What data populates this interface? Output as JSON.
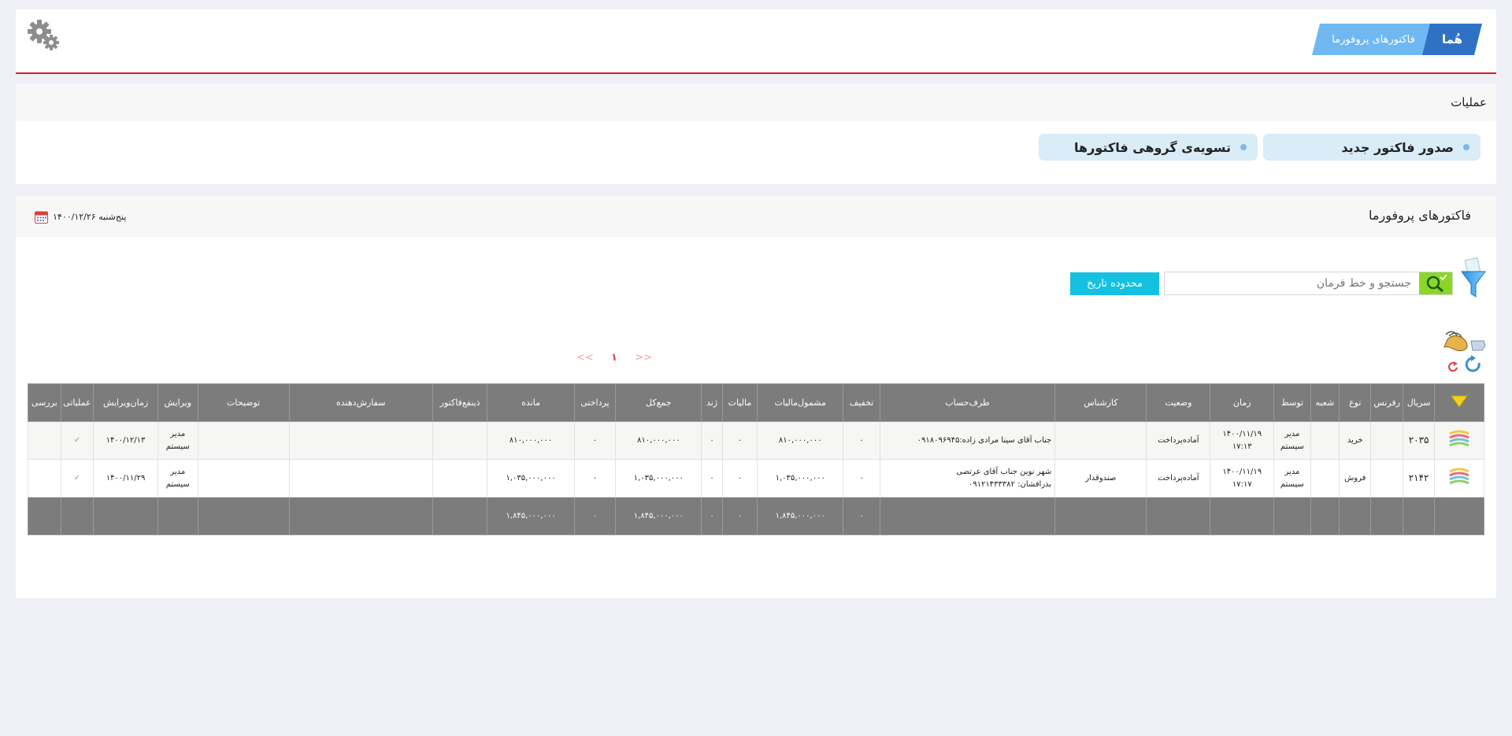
{
  "header": {
    "breadcrumb_home": "هُما",
    "breadcrumb_page": "فاکتورهای پروفورما"
  },
  "operations": {
    "title": "عملیات",
    "new_invoice": "صدور فاکتور جدید",
    "group_settle": "تسویه‌ی گروهی فاکتورها"
  },
  "invoices": {
    "title": "فاکتورهای پروفورما",
    "date": "پنج‌شنبه ۱۴۰۰/۱۲/۲۶",
    "search_placeholder": "جستجو و خط فرمان",
    "date_range_label": "محدوده تاریخ",
    "pager": {
      "prev": "<<",
      "page": "۱",
      "next": ">>"
    },
    "columns": [
      "سریال",
      "رفرنس",
      "نوع",
      "شعبه",
      "توسط",
      "زمان",
      "وضعیت",
      "کارشناس",
      "طرف‌حساب",
      "تخفیف",
      "مشمول‌مالیات",
      "مالیات",
      "ژند",
      "جمع‌کل",
      "پرداختی",
      "مانده",
      "ذینفع‌فاکتور",
      "سفارش‌دهنده",
      "توضیحات",
      "ویرایش",
      "زمان‌ویرایش",
      "عملیاتی",
      "بررسی"
    ],
    "rows": [
      {
        "serial": "۲۰۳۵",
        "type": "خرید",
        "by_1": "مدیر",
        "by_2": "سیستم",
        "date": "۱۴۰۰/۱۱/۱۹",
        "time": "۱۷:۱۳",
        "status": "آماده‌پرداخت",
        "expert": "",
        "party_1": "جناب آقای سینا مرادی زاده:۰۹۱۸۰۹۶۹۴۵",
        "party_2": "",
        "discount": "۰",
        "taxable": "۸۱۰,۰۰۰,۰۰۰",
        "tax": "۰",
        "zhand": "۰",
        "total": "۸۱۰,۰۰۰,۰۰۰",
        "paid": "۰",
        "remaining": "۸۱۰,۰۰۰,۰۰۰",
        "editor_1": "مدیر",
        "editor_2": "سیستم",
        "edit_time": "۱۴۰۰/۱۲/۱۳",
        "ops_check": "✔"
      },
      {
        "serial": "۲۱۴۲",
        "type": "فروش",
        "by_1": "مدیر",
        "by_2": "سیستم",
        "date": "۱۴۰۰/۱۱/۱۹",
        "time": "۱۷:۱۷",
        "status": "آماده‌پرداخت",
        "expert": "صندوقدار",
        "party_1": "شهر نوین جناب آقای عرتضی",
        "party_2": "بذرافشان: ۰۹۱۲۱۴۳۳۳۸۲",
        "discount": "۰",
        "taxable": "۱,۰۳۵,۰۰۰,۰۰۰",
        "tax": "۰",
        "zhand": "۰",
        "total": "۱,۰۳۵,۰۰۰,۰۰۰",
        "paid": "۰",
        "remaining": "۱,۰۳۵,۰۰۰,۰۰۰",
        "editor_1": "مدیر",
        "editor_2": "سیستم",
        "edit_time": "۱۴۰۰/۱۱/۲۹",
        "ops_check": "✔"
      }
    ],
    "totals": {
      "discount": "۰",
      "taxable": "۱,۸۴۵,۰۰۰,۰۰۰",
      "tax": "۰",
      "zhand": "۰",
      "total": "۱,۸۴۵,۰۰۰,۰۰۰",
      "paid": "۰",
      "remaining": "۱,۸۴۵,۰۰۰,۰۰۰"
    }
  },
  "colors": {
    "accent_red": "#d11f26",
    "breadcrumb_dark": "#2f72c4",
    "breadcrumb_light": "#6fb8f2",
    "search_green": "#8cd628",
    "date_button": "#14c1e1",
    "table_header": "#7c7c7c"
  },
  "icons": [
    "gear-icon",
    "calendar-icon",
    "filter-icon",
    "search-icon",
    "bird-icon",
    "refresh-icon",
    "row-type-icon",
    "sort-arrow-icon"
  ]
}
